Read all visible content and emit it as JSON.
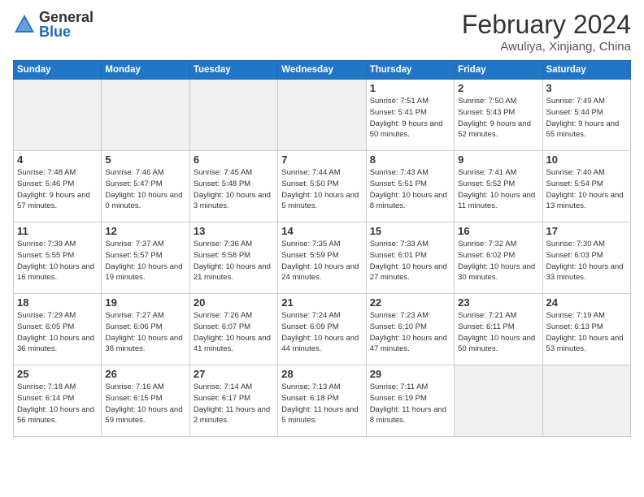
{
  "header": {
    "logo_general": "General",
    "logo_blue": "Blue",
    "title": "February 2024",
    "location": "Awuliya, Xinjiang, China"
  },
  "days_of_week": [
    "Sunday",
    "Monday",
    "Tuesday",
    "Wednesday",
    "Thursday",
    "Friday",
    "Saturday"
  ],
  "weeks": [
    {
      "row_class": "row-odd",
      "days": [
        {
          "num": "",
          "info": "",
          "empty": true
        },
        {
          "num": "",
          "info": "",
          "empty": true
        },
        {
          "num": "",
          "info": "",
          "empty": true
        },
        {
          "num": "",
          "info": "",
          "empty": true
        },
        {
          "num": "1",
          "info": "Sunrise: 7:51 AM\nSunset: 5:41 PM\nDaylight: 9 hours\nand 50 minutes.",
          "empty": false
        },
        {
          "num": "2",
          "info": "Sunrise: 7:50 AM\nSunset: 5:43 PM\nDaylight: 9 hours\nand 52 minutes.",
          "empty": false
        },
        {
          "num": "3",
          "info": "Sunrise: 7:49 AM\nSunset: 5:44 PM\nDaylight: 9 hours\nand 55 minutes.",
          "empty": false
        }
      ]
    },
    {
      "row_class": "row-even",
      "days": [
        {
          "num": "4",
          "info": "Sunrise: 7:48 AM\nSunset: 5:46 PM\nDaylight: 9 hours\nand 57 minutes.",
          "empty": false
        },
        {
          "num": "5",
          "info": "Sunrise: 7:46 AM\nSunset: 5:47 PM\nDaylight: 10 hours\nand 0 minutes.",
          "empty": false
        },
        {
          "num": "6",
          "info": "Sunrise: 7:45 AM\nSunset: 5:48 PM\nDaylight: 10 hours\nand 3 minutes.",
          "empty": false
        },
        {
          "num": "7",
          "info": "Sunrise: 7:44 AM\nSunset: 5:50 PM\nDaylight: 10 hours\nand 5 minutes.",
          "empty": false
        },
        {
          "num": "8",
          "info": "Sunrise: 7:43 AM\nSunset: 5:51 PM\nDaylight: 10 hours\nand 8 minutes.",
          "empty": false
        },
        {
          "num": "9",
          "info": "Sunrise: 7:41 AM\nSunset: 5:52 PM\nDaylight: 10 hours\nand 11 minutes.",
          "empty": false
        },
        {
          "num": "10",
          "info": "Sunrise: 7:40 AM\nSunset: 5:54 PM\nDaylight: 10 hours\nand 13 minutes.",
          "empty": false
        }
      ]
    },
    {
      "row_class": "row-odd",
      "days": [
        {
          "num": "11",
          "info": "Sunrise: 7:39 AM\nSunset: 5:55 PM\nDaylight: 10 hours\nand 16 minutes.",
          "empty": false
        },
        {
          "num": "12",
          "info": "Sunrise: 7:37 AM\nSunset: 5:57 PM\nDaylight: 10 hours\nand 19 minutes.",
          "empty": false
        },
        {
          "num": "13",
          "info": "Sunrise: 7:36 AM\nSunset: 5:58 PM\nDaylight: 10 hours\nand 21 minutes.",
          "empty": false
        },
        {
          "num": "14",
          "info": "Sunrise: 7:35 AM\nSunset: 5:59 PM\nDaylight: 10 hours\nand 24 minutes.",
          "empty": false
        },
        {
          "num": "15",
          "info": "Sunrise: 7:33 AM\nSunset: 6:01 PM\nDaylight: 10 hours\nand 27 minutes.",
          "empty": false
        },
        {
          "num": "16",
          "info": "Sunrise: 7:32 AM\nSunset: 6:02 PM\nDaylight: 10 hours\nand 30 minutes.",
          "empty": false
        },
        {
          "num": "17",
          "info": "Sunrise: 7:30 AM\nSunset: 6:03 PM\nDaylight: 10 hours\nand 33 minutes.",
          "empty": false
        }
      ]
    },
    {
      "row_class": "row-even",
      "days": [
        {
          "num": "18",
          "info": "Sunrise: 7:29 AM\nSunset: 6:05 PM\nDaylight: 10 hours\nand 36 minutes.",
          "empty": false
        },
        {
          "num": "19",
          "info": "Sunrise: 7:27 AM\nSunset: 6:06 PM\nDaylight: 10 hours\nand 38 minutes.",
          "empty": false
        },
        {
          "num": "20",
          "info": "Sunrise: 7:26 AM\nSunset: 6:07 PM\nDaylight: 10 hours\nand 41 minutes.",
          "empty": false
        },
        {
          "num": "21",
          "info": "Sunrise: 7:24 AM\nSunset: 6:09 PM\nDaylight: 10 hours\nand 44 minutes.",
          "empty": false
        },
        {
          "num": "22",
          "info": "Sunrise: 7:23 AM\nSunset: 6:10 PM\nDaylight: 10 hours\nand 47 minutes.",
          "empty": false
        },
        {
          "num": "23",
          "info": "Sunrise: 7:21 AM\nSunset: 6:11 PM\nDaylight: 10 hours\nand 50 minutes.",
          "empty": false
        },
        {
          "num": "24",
          "info": "Sunrise: 7:19 AM\nSunset: 6:13 PM\nDaylight: 10 hours\nand 53 minutes.",
          "empty": false
        }
      ]
    },
    {
      "row_class": "row-odd",
      "days": [
        {
          "num": "25",
          "info": "Sunrise: 7:18 AM\nSunset: 6:14 PM\nDaylight: 10 hours\nand 56 minutes.",
          "empty": false
        },
        {
          "num": "26",
          "info": "Sunrise: 7:16 AM\nSunset: 6:15 PM\nDaylight: 10 hours\nand 59 minutes.",
          "empty": false
        },
        {
          "num": "27",
          "info": "Sunrise: 7:14 AM\nSunset: 6:17 PM\nDaylight: 11 hours\nand 2 minutes.",
          "empty": false
        },
        {
          "num": "28",
          "info": "Sunrise: 7:13 AM\nSunset: 6:18 PM\nDaylight: 11 hours\nand 5 minutes.",
          "empty": false
        },
        {
          "num": "29",
          "info": "Sunrise: 7:11 AM\nSunset: 6:19 PM\nDaylight: 11 hours\nand 8 minutes.",
          "empty": false
        },
        {
          "num": "",
          "info": "",
          "empty": true
        },
        {
          "num": "",
          "info": "",
          "empty": true
        }
      ]
    }
  ]
}
